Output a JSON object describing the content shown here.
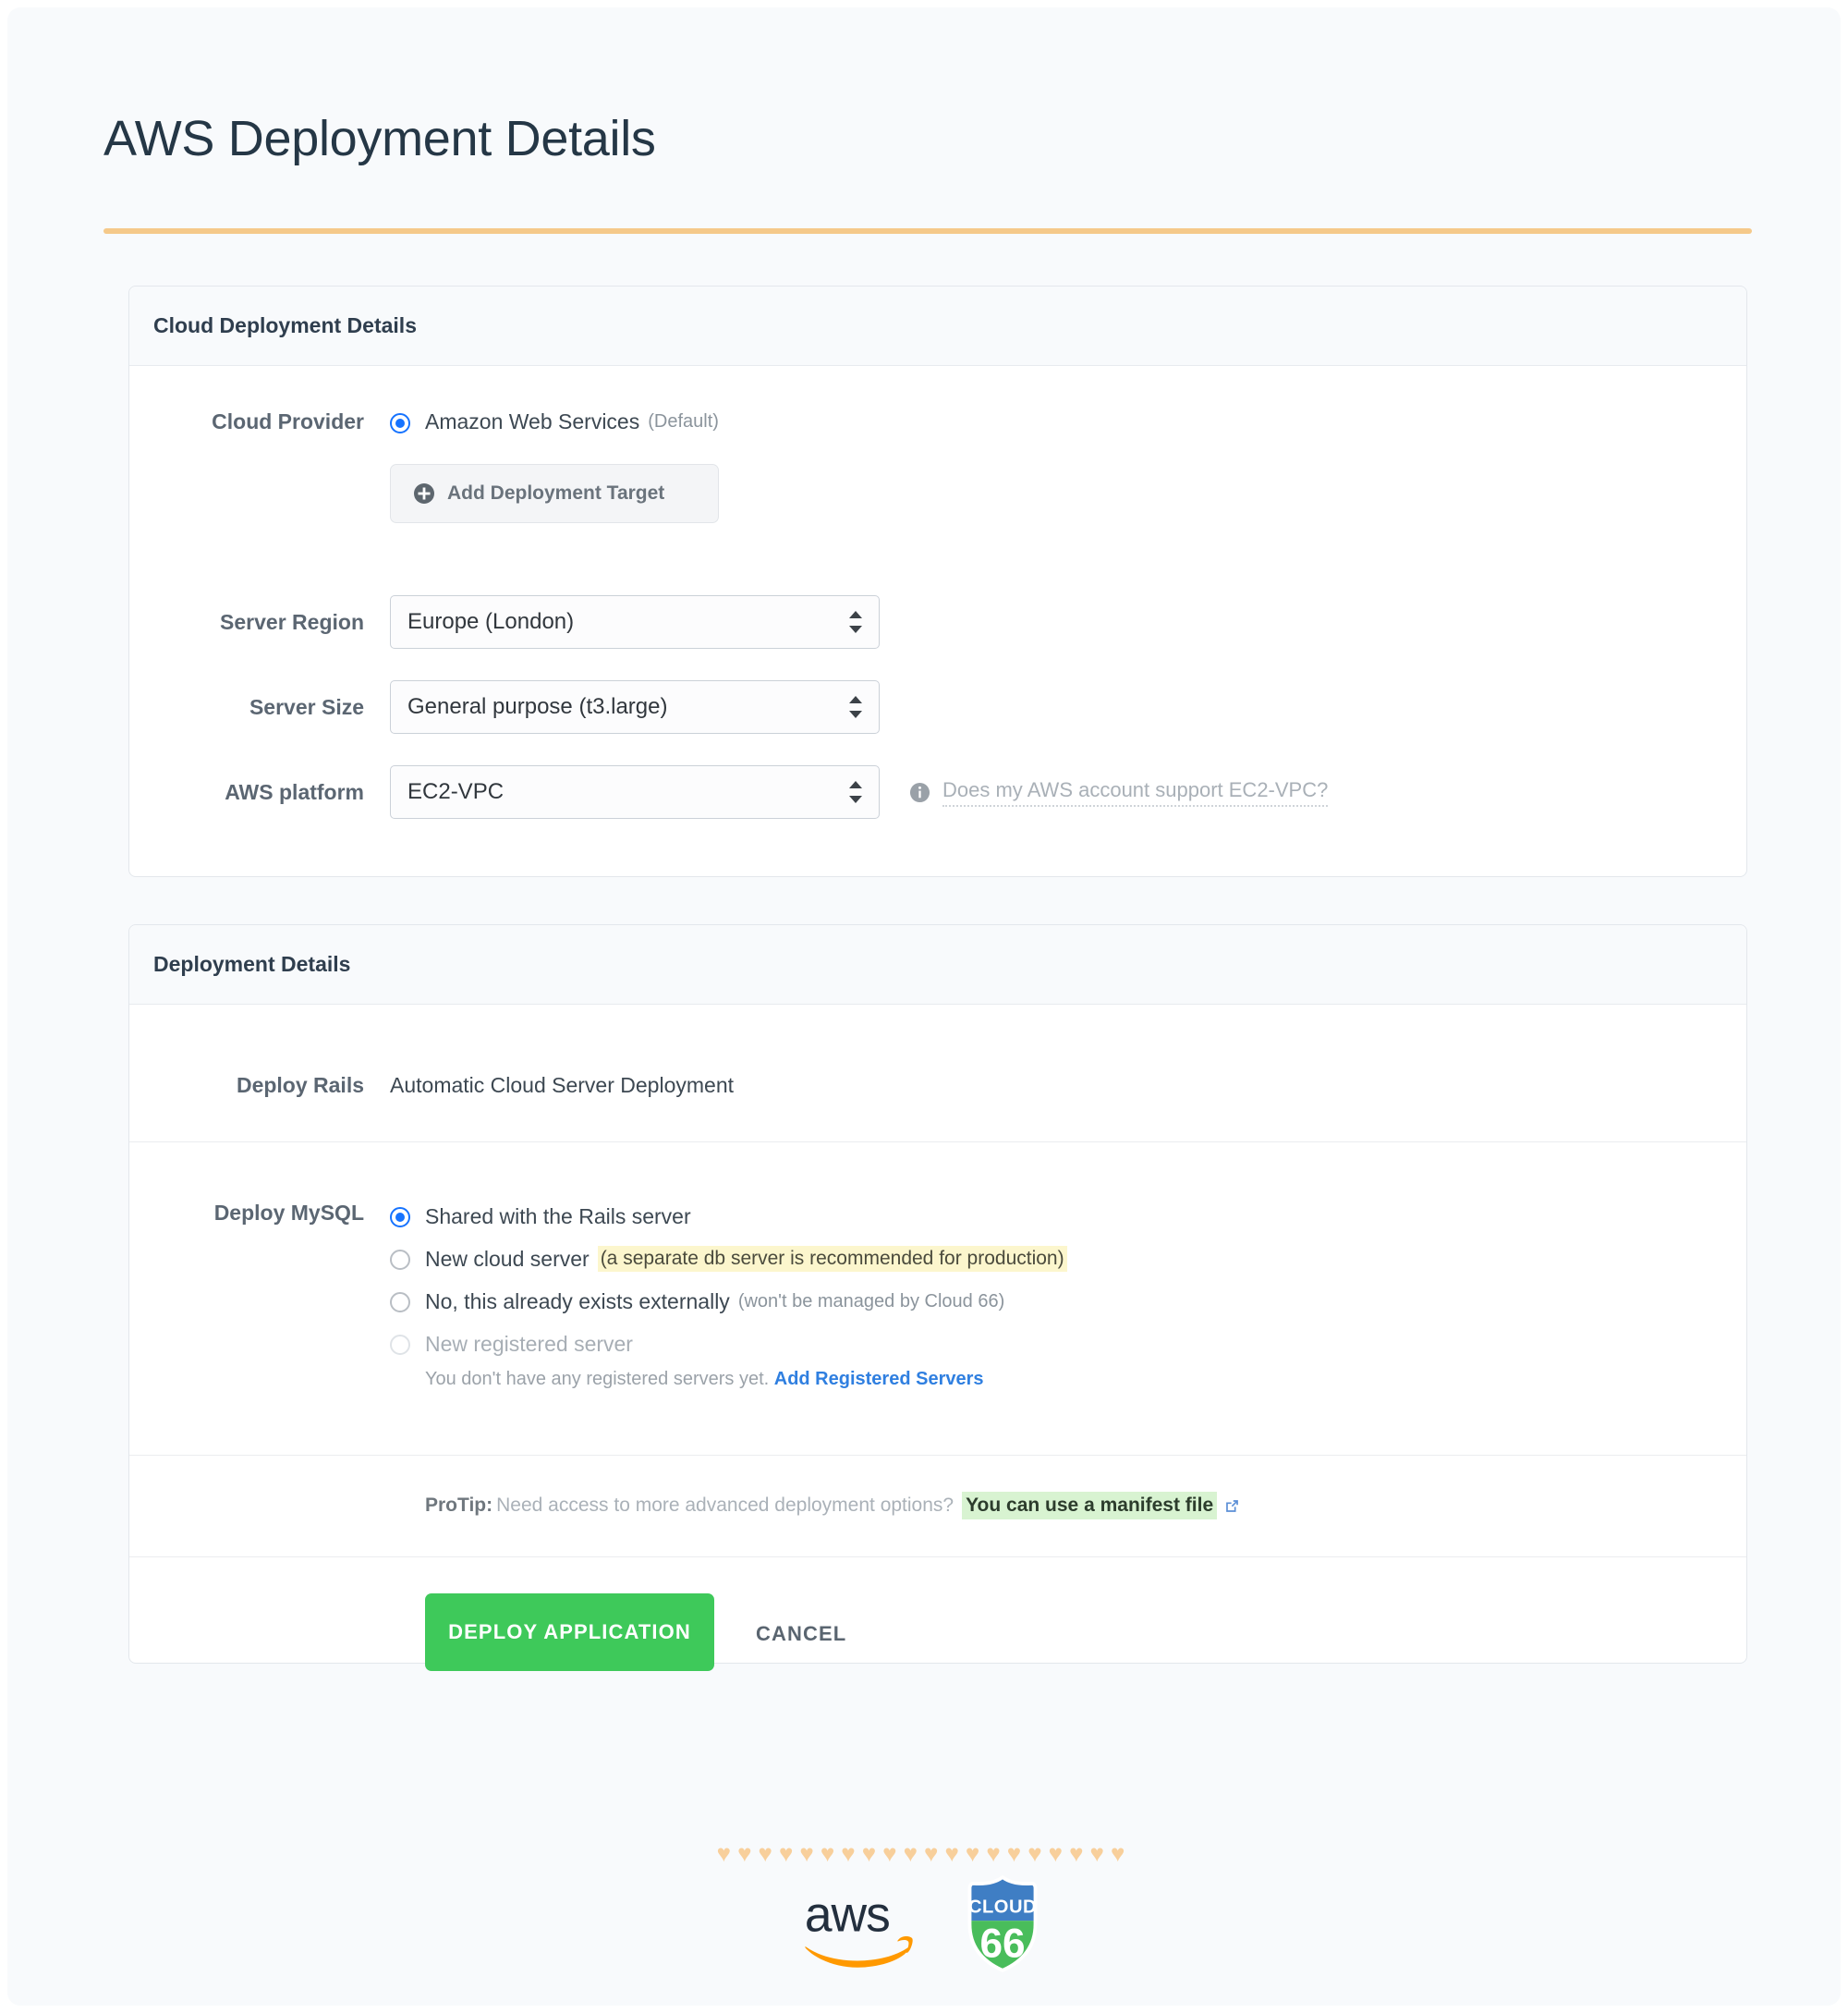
{
  "header": {
    "title": "AWS Deployment Details"
  },
  "cloud_card": {
    "title": "Cloud Deployment Details",
    "cloud_provider": {
      "label": "Cloud Provider",
      "option_label": "Amazon Web Services",
      "option_note": "(Default)",
      "selected": true
    },
    "add_target_button": "Add Deployment Target",
    "server_region": {
      "label": "Server Region",
      "value": "Europe (London)"
    },
    "server_size": {
      "label": "Server Size",
      "value": "General purpose (t3.large)"
    },
    "aws_platform": {
      "label": "AWS platform",
      "value": "EC2-VPC",
      "help_text": "Does my AWS account support EC2-VPC?"
    }
  },
  "deploy_card": {
    "title": "Deployment Details",
    "deploy_rails": {
      "label": "Deploy Rails",
      "value": "Automatic Cloud Server Deployment"
    },
    "deploy_mysql": {
      "label": "Deploy MySQL",
      "options": [
        {
          "text": "Shared with the Rails server",
          "note": "",
          "note_style": "none",
          "selected": true,
          "disabled": false
        },
        {
          "text": "New cloud server",
          "note": "(a separate db server is recommended for production)",
          "note_style": "yellow",
          "selected": false,
          "disabled": false
        },
        {
          "text": "No, this already exists externally",
          "note": "(won't be managed by Cloud 66)",
          "note_style": "grey",
          "selected": false,
          "disabled": false
        },
        {
          "text": "New registered server",
          "note": "",
          "note_style": "none",
          "selected": false,
          "disabled": true
        }
      ],
      "registered_help": "You don't have any registered servers yet.",
      "registered_link": "Add Registered Servers"
    },
    "protip": {
      "label": "ProTip:",
      "text": "Need access to more advanced deployment options?",
      "link": "You can use a manifest file"
    },
    "actions": {
      "deploy": "DEPLOY APPLICATION",
      "cancel": "CANCEL"
    }
  },
  "footer": {
    "hearts": "♥♥♥♥♥♥♥♥♥♥♥♥♥♥♥♥♥♥♥♥",
    "aws_wordmark": "aws",
    "cloud66_top": "CLOUD",
    "cloud66_bottom": "66"
  },
  "colors": {
    "accent_rule": "#f5c98a",
    "radio_blue": "#1673ff",
    "deploy_green": "#3ec95a",
    "link_blue": "#2f7fe0",
    "highlight_yellow": "#fcf6cd",
    "highlight_green": "#d8f3d1",
    "title_navy": "#253746"
  }
}
